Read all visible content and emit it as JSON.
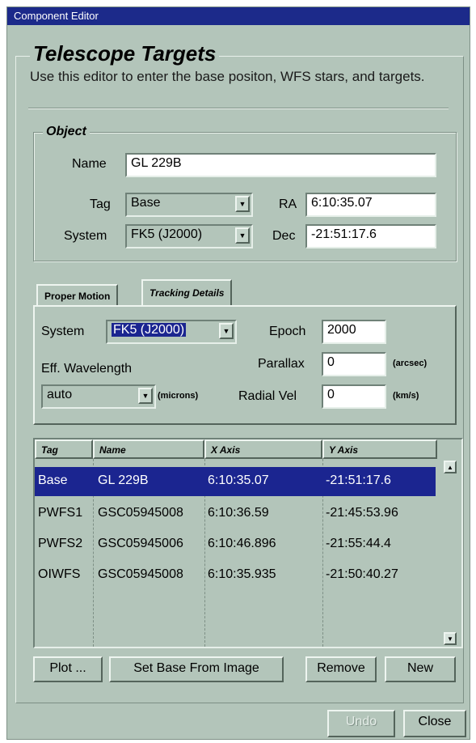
{
  "window": {
    "title": "Component Editor"
  },
  "header": {
    "title": "Telescope Targets",
    "description": "Use this editor to enter the base positon, WFS stars, and targets."
  },
  "object": {
    "legend": "Object",
    "name_label": "Name",
    "name_value": "GL 229B",
    "tag_label": "Tag",
    "tag_value": "Base",
    "system_label": "System",
    "system_value": "FK5 (J2000)",
    "ra_label": "RA",
    "ra_value": "6:10:35.07",
    "dec_label": "Dec",
    "dec_value": "-21:51:17.6"
  },
  "tabs": [
    {
      "label": "Proper Motion"
    },
    {
      "label": "Tracking Details"
    }
  ],
  "tracking": {
    "system_label": "System",
    "system_value": "FK5 (J2000)",
    "epoch_label": "Epoch",
    "epoch_value": "2000",
    "eff_wavelength_label": "Eff. Wavelength",
    "eff_wavelength_value": "auto",
    "eff_wavelength_unit": "(microns)",
    "parallax_label": "Parallax",
    "parallax_value": "0",
    "parallax_unit": "(arcsec)",
    "radial_vel_label": "Radial Vel",
    "radial_vel_value": "0",
    "radial_vel_unit": "(km/s)"
  },
  "table": {
    "columns": [
      "Tag",
      "Name",
      "X Axis",
      "Y Axis"
    ],
    "rows": [
      {
        "tag": "Base",
        "name": "GL 229B",
        "x": "6:10:35.07",
        "y": "-21:51:17.6"
      },
      {
        "tag": "PWFS1",
        "name": "GSC05945008",
        "x": "6:10:36.59",
        "y": "-21:45:53.96"
      },
      {
        "tag": "PWFS2",
        "name": "GSC05945006",
        "x": "6:10:46.896",
        "y": "-21:55:44.4"
      },
      {
        "tag": "OIWFS",
        "name": "GSC05945008",
        "x": "6:10:35.935",
        "y": "-21:50:40.27"
      }
    ]
  },
  "buttons": {
    "plot": "Plot ...",
    "set_base": "Set Base From Image",
    "remove": "Remove",
    "new": "New",
    "undo": "Undo",
    "close": "Close"
  },
  "colors": {
    "window_bg": "#b3c5ba",
    "titlebar": "#1c2a8a",
    "selection": "#1b2590"
  }
}
